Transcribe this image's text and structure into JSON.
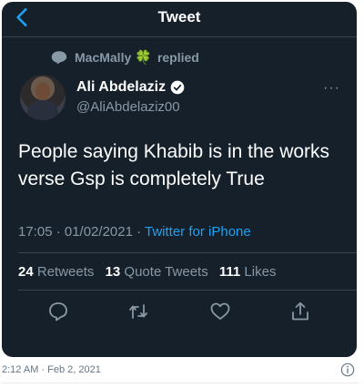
{
  "header": {
    "title": "Tweet"
  },
  "reply_context": {
    "name": "MacMally",
    "emoji": "🍀",
    "label": "replied"
  },
  "author": {
    "name": "Ali Abdelaziz",
    "handle": "@AliAbdelaziz00"
  },
  "tweet": {
    "text": "People saying Khabib is in the works verse Gsp is completely True",
    "time": "17:05 · 01/02/2021 · ",
    "client": "Twitter for iPhone"
  },
  "stats": {
    "retweets_count": "24",
    "retweets_label": "Retweets",
    "quotes_count": "13",
    "quotes_label": "Quote Tweets",
    "likes_count": "111",
    "likes_label": "Likes"
  },
  "more_menu": "···",
  "footer": {
    "timestamp": "2:12 AM · Feb 2, 2021"
  },
  "colors": {
    "background": "#15202b",
    "accent": "#1da1f2",
    "secondary": "#8899a6"
  },
  "icons": [
    "back-arrow-icon",
    "reply-bubble-icon",
    "verified-icon",
    "more-icon",
    "reply-icon",
    "retweet-icon",
    "like-icon",
    "share-icon",
    "info-icon"
  ]
}
